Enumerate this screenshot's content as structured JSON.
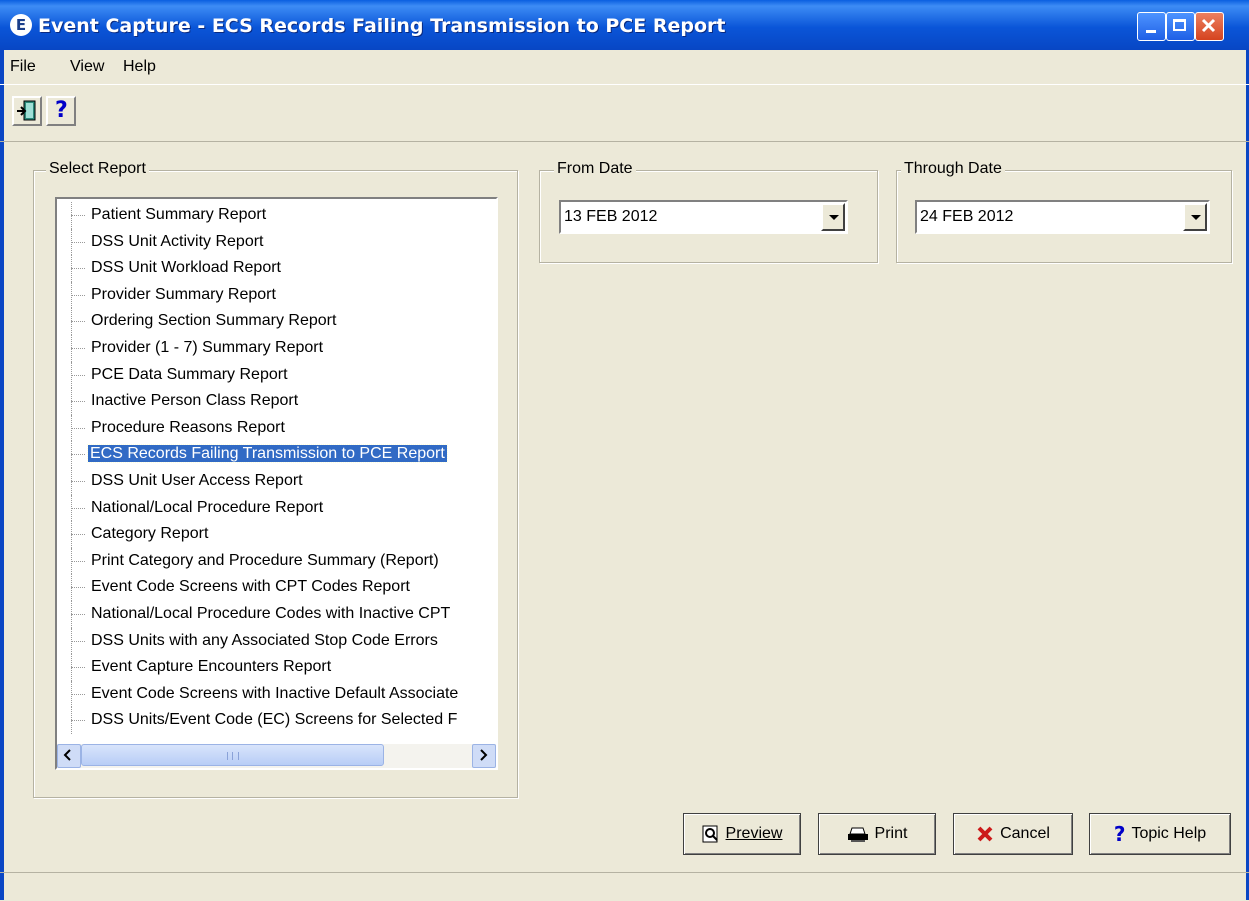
{
  "window": {
    "title": "Event Capture - ECS Records Failing Transmission to PCE Report",
    "icon_letter": "E"
  },
  "menu": [
    "File",
    "View",
    "Help"
  ],
  "toolbar": {
    "exit_icon": "exit-door-icon",
    "help_label": "?"
  },
  "select_report": {
    "legend": "Select Report",
    "items": [
      "Patient Summary Report",
      "DSS Unit Activity Report",
      "DSS Unit Workload Report",
      "Provider Summary Report",
      "Ordering Section Summary Report",
      "Provider (1 - 7) Summary Report",
      "PCE Data Summary Report",
      "Inactive Person Class Report",
      "Procedure Reasons Report",
      "ECS Records Failing Transmission to PCE Report",
      "DSS Unit User Access Report",
      "National/Local Procedure Report",
      "Category Report",
      "Print Category and Procedure Summary (Report)",
      "Event Code Screens with CPT Codes Report",
      "National/Local Procedure Codes with Inactive CPT",
      "DSS Units with any Associated Stop Code Errors",
      "Event Capture Encounters Report",
      "Event Code Screens with Inactive Default Associate",
      "DSS Units/Event Code (EC) Screens for Selected F"
    ],
    "selected": "ECS Records Failing Transmission to PCE Report"
  },
  "from_date": {
    "legend": "From Date",
    "value": "13 FEB 2012"
  },
  "through_date": {
    "legend": "Through Date",
    "value": "24 FEB 2012"
  },
  "buttons": {
    "preview": "Preview",
    "print": "Print",
    "cancel": "Cancel",
    "topic_help": "Topic Help"
  },
  "colors": {
    "title_bar": "#0a55d8",
    "selection": "#316ac5",
    "face": "#ece9d8"
  }
}
